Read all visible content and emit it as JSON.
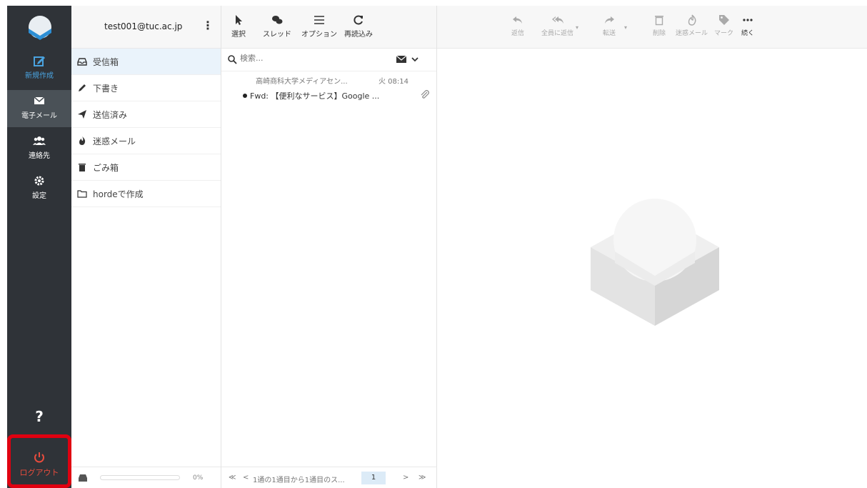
{
  "rail": {
    "items": [
      {
        "label": "新規作成",
        "icon": "compose-icon"
      },
      {
        "label": "電子メール",
        "icon": "envelope-icon"
      },
      {
        "label": "連絡先",
        "icon": "contacts-icon"
      },
      {
        "label": "設定",
        "icon": "gear-icon"
      }
    ],
    "help_label": "?",
    "logout_label": "ログアウト",
    "colors": {
      "bg": "#2f3338",
      "active": "#4a5157",
      "accent": "#4aa3df",
      "logout_frame": "#e00010"
    }
  },
  "account": {
    "email": "test001@tuc.ac.jp"
  },
  "folders": [
    {
      "label": "受信箱",
      "icon": "inbox-icon"
    },
    {
      "label": "下書き",
      "icon": "pencil-icon"
    },
    {
      "label": "送信済み",
      "icon": "paper-plane-icon"
    },
    {
      "label": "迷惑メール",
      "icon": "fire-icon"
    },
    {
      "label": "ごみ箱",
      "icon": "trash-icon"
    },
    {
      "label": "hordeで作成",
      "icon": "folder-icon"
    }
  ],
  "quota": {
    "percent": "0%",
    "fill": 0
  },
  "list_toolbar": [
    {
      "label": "選択",
      "icon": "pointer-icon"
    },
    {
      "label": "スレッド",
      "icon": "comments-icon"
    },
    {
      "label": "オプション",
      "icon": "sliders-icon"
    },
    {
      "label": "再読込み",
      "icon": "refresh-icon"
    }
  ],
  "search": {
    "placeholder": "検索..."
  },
  "messages": [
    {
      "from": "高崎商科大学メディアセン...",
      "date": "火 08:14",
      "subject": "Fwd: 【便利なサービス】Google ...",
      "unread": true,
      "attachment": true
    }
  ],
  "pager": {
    "first": "≪",
    "prev": "<",
    "summary": "1通の1通目から1通目のス...",
    "page": "1",
    "next": ">",
    "last": "≫"
  },
  "actions": [
    {
      "label": "返信",
      "icon": "reply-icon"
    },
    {
      "label": "全員に返信",
      "icon": "reply-all-icon"
    },
    {
      "label": "転送",
      "icon": "forward-icon"
    },
    {
      "label": "削除",
      "icon": "trash-icon"
    },
    {
      "label": "迷惑メール",
      "icon": "fire-icon"
    },
    {
      "label": "マーク",
      "icon": "tag-icon"
    },
    {
      "label": "続く",
      "icon": "more-icon"
    }
  ]
}
